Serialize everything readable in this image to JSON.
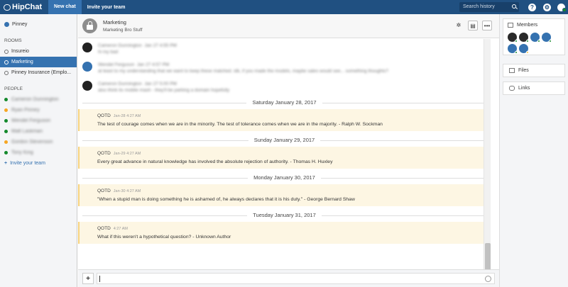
{
  "app": {
    "name": "HipChat"
  },
  "topbar": {
    "new_chat": "New chat",
    "invite": "Invite your team",
    "search_placeholder": "Search history"
  },
  "sidebar": {
    "team": "Pinney",
    "rooms_label": "ROOMS",
    "rooms": [
      {
        "label": "Insureio",
        "active": false
      },
      {
        "label": "Marketing",
        "active": true
      },
      {
        "label": "Pinney Insurance (Emplo...",
        "active": false
      }
    ],
    "people_label": "PEOPLE",
    "people": [
      {
        "label": "Cameron Dunnington",
        "status_color": "#14892c"
      },
      {
        "label": "Ryan Pinney",
        "status_color": "#f6a623"
      },
      {
        "label": "Wendel Ferguson",
        "status_color": "#14892c"
      },
      {
        "label": "Matt Laskman",
        "status_color": "#14892c"
      },
      {
        "label": "Gordon Stevenson",
        "status_color": "#f6a623"
      },
      {
        "label": "Tony King",
        "status_color": "#14892c"
      }
    ],
    "invite": "Invite your team"
  },
  "room": {
    "name": "Marketing",
    "topic": "Marketing Bro Stuff"
  },
  "messages": {
    "early": [
      {
        "author": "Cameron Dunnington",
        "time": "Jan 27 4:55 PM",
        "text": "hi my bad",
        "avatar": "dark"
      },
      {
        "author": "Wendel Ferguson",
        "time": "Jan 27 4:57 PM",
        "text": "at least to my understanding that we want to keep these matched. idk, if you made the models, maybe sales would see... something thoughts?",
        "avatar": "blue"
      },
      {
        "author": "Cameron Dunnington",
        "time": "Jan 27 5:00 PM",
        "text": "also think its mobile mash - they'll be parking a domain hopefully",
        "avatar": "dark"
      }
    ],
    "days": [
      {
        "date": "Saturday January 28, 2017",
        "author": "QOTD",
        "time": "Jan-28 4:27 AM",
        "text": "The test of courage comes when we are in the minority. The test of tolerance comes when we are in the majority. - Ralph W. Sockman"
      },
      {
        "date": "Sunday January 29, 2017",
        "author": "QOTD",
        "time": "Jan-29 4:27 AM",
        "text": "Every great advance in natural knowledge has involved the absolute rejection of authority. - Thomas H. Huxley"
      },
      {
        "date": "Monday January 30, 2017",
        "author": "QOTD",
        "time": "Jan-30 4:27 AM",
        "text": "\"When a stupid man is doing something he is ashamed of, he always declares that it is his duty.\" - George Bernard Shaw"
      },
      {
        "date": "Tuesday January 31, 2017",
        "author": "QOTD",
        "time": "4:27 AM",
        "text": "What if this weren't a hypothetical question? - Unknown Author"
      }
    ]
  },
  "composer": {
    "add": "+"
  },
  "rightpanel": {
    "members_label": "Members",
    "files_label": "Files",
    "links_label": "Links"
  },
  "colors": {
    "brand": "#205081",
    "accent": "#3572b0",
    "qotd_bg": "#fdf6e3"
  }
}
